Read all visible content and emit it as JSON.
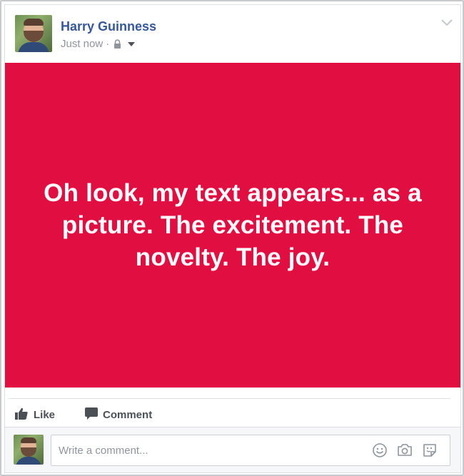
{
  "post": {
    "author": "Harry Guinness",
    "timestamp": "Just now",
    "separator": "·",
    "privacy_icon": "lock-icon",
    "audience_dropdown_icon": "caret-down-icon",
    "options_icon": "chevron-down-icon",
    "text": "Oh look, my text appears... as a picture. The excitement. The novelty. The joy.",
    "background_color": "#e00e41",
    "text_color": "#ffffff"
  },
  "actions": {
    "like_label": "Like",
    "comment_label": "Comment"
  },
  "comment": {
    "placeholder": "Write a comment...",
    "icons": [
      "emoji-icon",
      "camera-icon",
      "sticker-icon"
    ]
  },
  "colors": {
    "author_link": "#365899",
    "meta_text": "#90949c",
    "action_text": "#4b4f56"
  }
}
